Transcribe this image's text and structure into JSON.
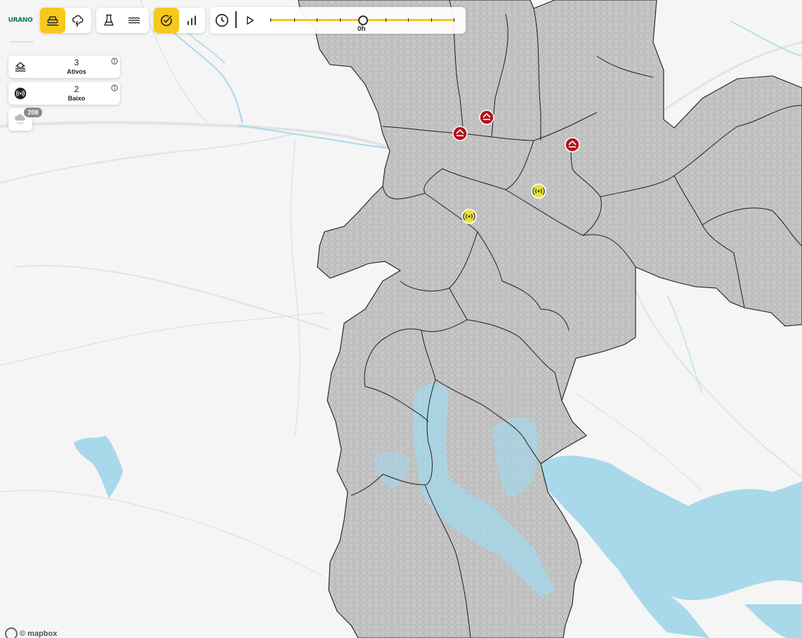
{
  "brand": {
    "name": "URANO"
  },
  "toolbar": {
    "groups": [
      {
        "buttons": [
          {
            "icon": "flood-car-icon",
            "active": true
          },
          {
            "icon": "storm-cloud-icon",
            "active": false
          }
        ]
      },
      {
        "buttons": [
          {
            "icon": "flask-icon",
            "active": false
          },
          {
            "icon": "waves-icon",
            "active": false
          }
        ]
      },
      {
        "buttons": [
          {
            "icon": "check-circle-icon",
            "active": true
          },
          {
            "icon": "bar-chart-icon",
            "active": false
          }
        ]
      }
    ]
  },
  "timeline": {
    "label": "0h",
    "position": 0.5
  },
  "panels": [
    {
      "icon": "flood-house-icon",
      "count": "3",
      "label": "Ativos"
    },
    {
      "icon": "signal-icon",
      "count": "2",
      "label": "Baixo"
    }
  ],
  "weather": {
    "badge": "208"
  },
  "map": {
    "attribution": "© mapbox",
    "markers": [
      {
        "kind": "flood",
        "color": "#b3131b"
      },
      {
        "kind": "flood",
        "color": "#b3131b"
      },
      {
        "kind": "flood",
        "color": "#b3131b"
      },
      {
        "kind": "signal",
        "color": "#e7e238"
      },
      {
        "kind": "signal",
        "color": "#e7e238"
      }
    ]
  },
  "colors": {
    "accent": "#f6c81c",
    "region_fill": "#c6c6c6",
    "water": "#a8d9ea",
    "alert_red": "#b3131b",
    "alert_yellow": "#e7e238"
  }
}
